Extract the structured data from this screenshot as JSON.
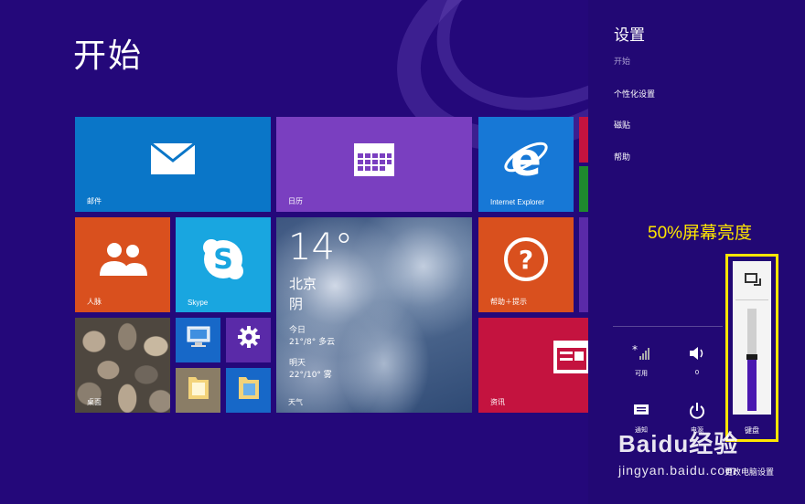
{
  "start": {
    "title": "开始",
    "tiles": {
      "mail": "邮件",
      "calendar": "日历",
      "ie": "Internet Explorer",
      "people": "人脉",
      "skype": "Skype",
      "help": "帮助＋提示",
      "desktop": "桌面",
      "news": "资讯"
    },
    "weather": {
      "temp": "14°",
      "city": "北京",
      "condition": "阴",
      "today_label": "今日",
      "today": "21°/8° 多云",
      "tomorrow_label": "明天",
      "tomorrow": "22°/10° 雾",
      "label": "天气"
    }
  },
  "charms": {
    "title": "设置",
    "subtitle": "开始",
    "links": [
      "个性化设置",
      "磁贴",
      "帮助"
    ],
    "quick": {
      "network_label": "可用",
      "volume_label": "0",
      "notifications_label": "通知",
      "power_label": "电源",
      "keyboard_label": "键盘"
    },
    "brightness_level": 0.5,
    "change_pc_settings": "更改电脑设置"
  },
  "annotation": "50%屏幕亮度",
  "watermark": {
    "logo": "Baidu经验",
    "url": "jingyan.baidu.com"
  },
  "colors": {
    "mail": "#0a76c8",
    "calendar": "#7a3fc0",
    "ie": "#1778d6",
    "people": "#d9501e",
    "skype": "#19a6e0",
    "help": "#d9501e",
    "news": "#c4133f",
    "charms_bg": "#220874",
    "highlight": "#ffe600"
  }
}
